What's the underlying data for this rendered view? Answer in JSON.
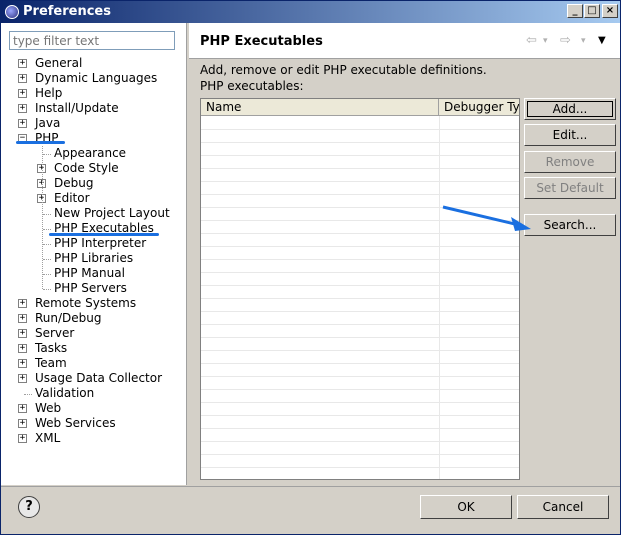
{
  "window": {
    "title": "Preferences",
    "min": "_",
    "max": "□",
    "close": "×"
  },
  "filter": {
    "placeholder": "type filter text"
  },
  "tree": {
    "items": [
      {
        "label": "General",
        "expander": "+"
      },
      {
        "label": "Dynamic Languages",
        "expander": "+"
      },
      {
        "label": "Help",
        "expander": "+"
      },
      {
        "label": "Install/Update",
        "expander": "+"
      },
      {
        "label": "Java",
        "expander": "+"
      },
      {
        "label": "PHP",
        "expander": "−"
      },
      {
        "label": "Appearance",
        "expander": ""
      },
      {
        "label": "Code Style",
        "expander": "+"
      },
      {
        "label": "Debug",
        "expander": "+"
      },
      {
        "label": "Editor",
        "expander": "+"
      },
      {
        "label": "New Project Layout",
        "expander": ""
      },
      {
        "label": "PHP Executables",
        "expander": ""
      },
      {
        "label": "PHP Interpreter",
        "expander": ""
      },
      {
        "label": "PHP Libraries",
        "expander": ""
      },
      {
        "label": "PHP Manual",
        "expander": ""
      },
      {
        "label": "PHP Servers",
        "expander": ""
      },
      {
        "label": "Remote Systems",
        "expander": "+"
      },
      {
        "label": "Run/Debug",
        "expander": "+"
      },
      {
        "label": "Server",
        "expander": "+"
      },
      {
        "label": "Tasks",
        "expander": "+"
      },
      {
        "label": "Team",
        "expander": "+"
      },
      {
        "label": "Usage Data Collector",
        "expander": "+"
      },
      {
        "label": "Validation",
        "expander": ""
      },
      {
        "label": "Web",
        "expander": "+"
      },
      {
        "label": "Web Services",
        "expander": "+"
      },
      {
        "label": "XML",
        "expander": "+"
      }
    ]
  },
  "page": {
    "title": "PHP Executables",
    "nav": {
      "back": "⇦",
      "back_menu": "▾",
      "forward": "⇨",
      "forward_menu": "▾",
      "menu": "▼"
    },
    "description": "Add, remove or edit PHP executable definitions.",
    "list_label": "PHP executables:",
    "columns": [
      "Name",
      "Debugger Ty"
    ],
    "buttons": {
      "add": "Add...",
      "edit": "Edit...",
      "remove": "Remove",
      "set_default": "Set Default",
      "search": "Search..."
    }
  },
  "footer": {
    "help": "?",
    "ok": "OK",
    "cancel": "Cancel"
  },
  "colors": {
    "title_bar": "#0a246a",
    "annotation": "#1a6fe0",
    "face": "#d4d0c8"
  }
}
